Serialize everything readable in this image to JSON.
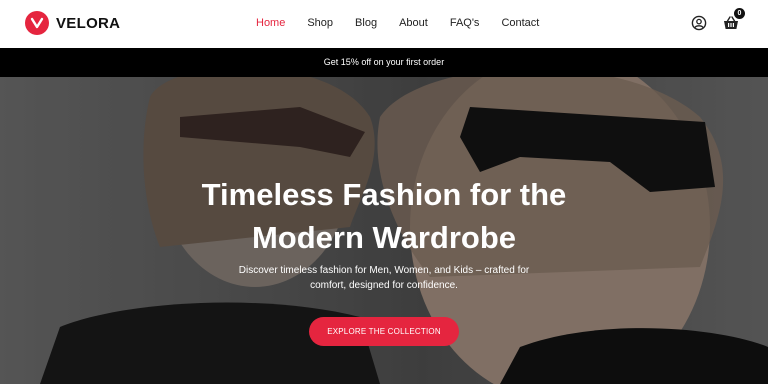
{
  "brand": {
    "name": "VELORA",
    "accent": "#e5253f"
  },
  "nav": {
    "items": [
      {
        "label": "Home",
        "active": true
      },
      {
        "label": "Shop"
      },
      {
        "label": "Blog"
      },
      {
        "label": "About"
      },
      {
        "label": "FAQ's"
      },
      {
        "label": "Contact"
      }
    ]
  },
  "header_icons": {
    "account": "user-circle-icon",
    "cart": "basket-icon",
    "cart_count": "0"
  },
  "promo": {
    "text": "Get 15% off on your first order"
  },
  "hero": {
    "title_line1": "Timeless Fashion for the",
    "title_line2": "Modern Wardrobe",
    "subtitle": "Discover timeless fashion for Men, Women, and Kids – crafted for comfort, designed for confidence.",
    "cta_label": "EXPLORE THE COLLECTION"
  }
}
